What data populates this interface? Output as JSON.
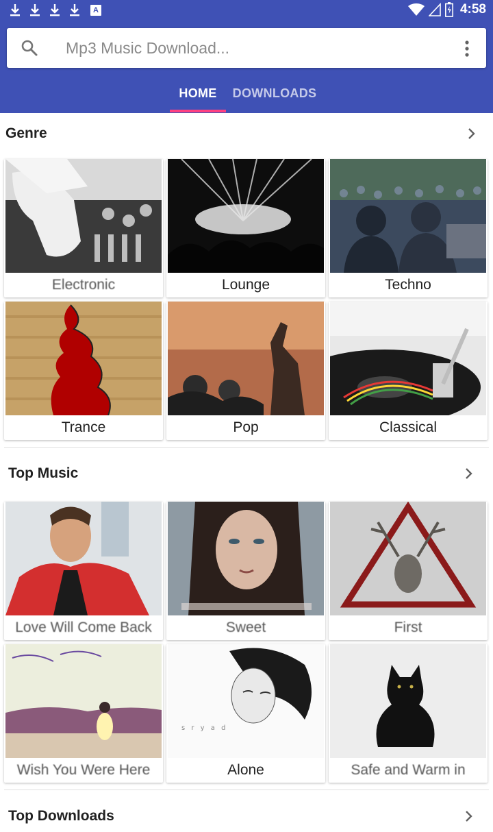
{
  "status_bar": {
    "time": "4:58",
    "icons": [
      "download-icon",
      "download-icon",
      "download-icon",
      "download-icon",
      "text-a-icon",
      "wifi-icon",
      "signal-icon",
      "battery-icon"
    ],
    "badge_letter": "A"
  },
  "search": {
    "placeholder": "Mp3 Music Download..."
  },
  "tabs": [
    {
      "label": "HOME",
      "active": true
    },
    {
      "label": "DOWNLOADS",
      "active": false
    }
  ],
  "sections": {
    "genre": {
      "title": "Genre",
      "items": [
        {
          "label": "Electronic"
        },
        {
          "label": "Lounge"
        },
        {
          "label": "Techno"
        },
        {
          "label": "Trance"
        },
        {
          "label": "Pop"
        },
        {
          "label": "Classical"
        }
      ]
    },
    "top_music": {
      "title": "Top Music",
      "items": [
        {
          "label": "Love Will Come Back"
        },
        {
          "label": "Sweet"
        },
        {
          "label": "First"
        },
        {
          "label": "Wish You Were Here"
        },
        {
          "label": "Alone"
        },
        {
          "label": "Safe and Warm in"
        }
      ]
    },
    "top_downloads": {
      "title": "Top Downloads"
    }
  },
  "colors": {
    "primary": "#3f51b5",
    "accent": "#ff4081",
    "tab_inactive": "#c5cae9"
  }
}
